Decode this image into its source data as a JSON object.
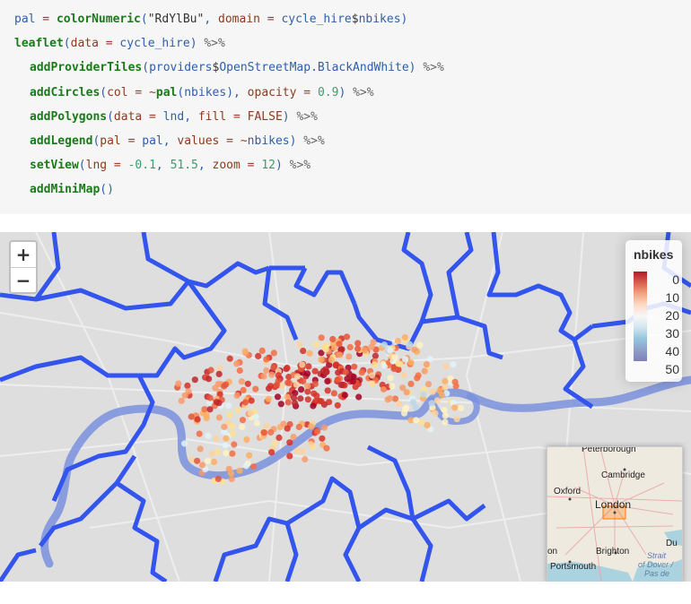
{
  "code": {
    "line1": {
      "a": "pal",
      "b": " = ",
      "c": "colorNumeric",
      "d": "(",
      "e": "\"RdYlBu\"",
      "f": ", ",
      "g": "domain",
      "h": " = ",
      "i": "cycle_hire",
      "j": "$",
      "k": "nbikes",
      "l": ")"
    },
    "line2": {
      "a": "leaflet",
      "b": "(",
      "c": "data",
      "d": " = ",
      "e": "cycle_hire",
      "f": ") ",
      "g": "%>%"
    },
    "line3": {
      "a": "addProviderTiles",
      "b": "(",
      "c": "providers",
      "d": "$",
      "e": "OpenStreetMap.BlackAndWhite",
      "f": ") ",
      "g": "%>%"
    },
    "line4": {
      "a": "addCircles",
      "b": "(",
      "c": "col",
      "d": " = ~",
      "e": "pal",
      "f": "(",
      "g": "nbikes",
      "h": "), ",
      "i": "opacity",
      "j": " = ",
      "k": "0.9",
      "l": ") ",
      "m": "%>%"
    },
    "line5": {
      "a": "addPolygons",
      "b": "(",
      "c": "data",
      "d": " = ",
      "e": "lnd",
      "f": ", ",
      "g": "fill",
      "h": " = ",
      "i": "FALSE",
      "j": ") ",
      "k": "%>%"
    },
    "line6": {
      "a": "addLegend",
      "b": "(",
      "c": "pal",
      "d": " = ",
      "e": "pal",
      "f": ", ",
      "g": "values",
      "h": " = ~",
      "i": "nbikes",
      "j": ") ",
      "k": "%>%"
    },
    "line7": {
      "a": "setView",
      "b": "(",
      "c": "lng",
      "d": " = ",
      "e": "-0.1",
      "f": ", ",
      "g": "51.5",
      "h": ", ",
      "i": "zoom",
      "j": " = ",
      "k": "12",
      "l": ") ",
      "m": "%>%"
    },
    "line8": {
      "a": "addMiniMap",
      "b": "()"
    }
  },
  "map": {
    "zoom_in": "+",
    "zoom_out": "−",
    "legend": {
      "title": "nbikes",
      "labels": [
        "0",
        "10",
        "20",
        "30",
        "40",
        "50"
      ],
      "palette": "RdYlBu"
    },
    "minimap": {
      "places": {
        "peterborough": "Peterborough",
        "cambridge": "Cambridge",
        "oxford": "Oxford",
        "london": "London",
        "brighton": "Brighton",
        "portsmouth": "Portsmouth",
        "du": "Du",
        "on": "on"
      },
      "sea": {
        "strait": "Strait",
        "of_dover": "of Dover /",
        "pas_de": "Pas de"
      }
    }
  },
  "colors": {
    "boundary": "#3355ee",
    "river": "#7a90dd",
    "map_bg": "#dedede",
    "code_bg": "#f6f6f6"
  }
}
